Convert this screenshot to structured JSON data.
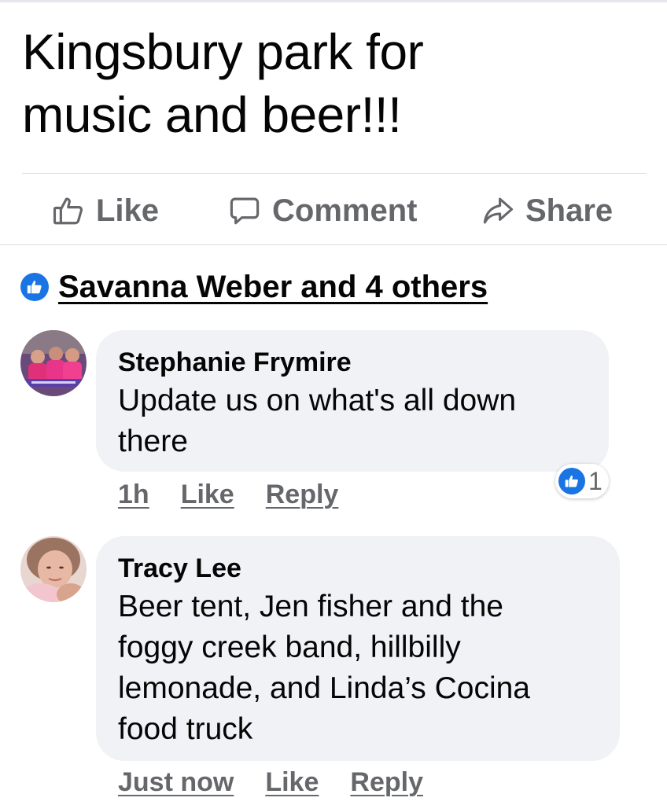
{
  "post": {
    "text_line1": "Kingsbury park for",
    "text_line2": "music and beer!!!"
  },
  "actions": {
    "like": {
      "label": "Like",
      "icon": "thumbs-up-outline-icon"
    },
    "comment": {
      "label": "Comment",
      "icon": "speech-bubble-icon"
    },
    "share": {
      "label": "Share",
      "icon": "share-arrow-icon"
    }
  },
  "reactions": {
    "icon": "like-reaction-icon",
    "summary": "Savanna Weber and 4 others"
  },
  "comments": [
    {
      "author": "Stephanie Frymire",
      "text_line1": "Update us on what's all down",
      "text_line2": "there",
      "time": "1h",
      "like_label": "Like",
      "reply_label": "Reply",
      "reaction_count": "1"
    },
    {
      "author": "Tracy Lee",
      "text_line1": "Beer tent, Jen fisher and the",
      "text_line2": "foggy creek band, hillbilly",
      "text_line3": "lemonade, and Linda’s Cocina",
      "text_line4": "food truck",
      "time": "Just now",
      "like_label": "Like",
      "reply_label": "Reply"
    }
  ],
  "colors": {
    "accent": "#1b74e4",
    "secondary_text": "#65676b",
    "bubble": "#f0f2f5",
    "divider": "#dadde1"
  }
}
